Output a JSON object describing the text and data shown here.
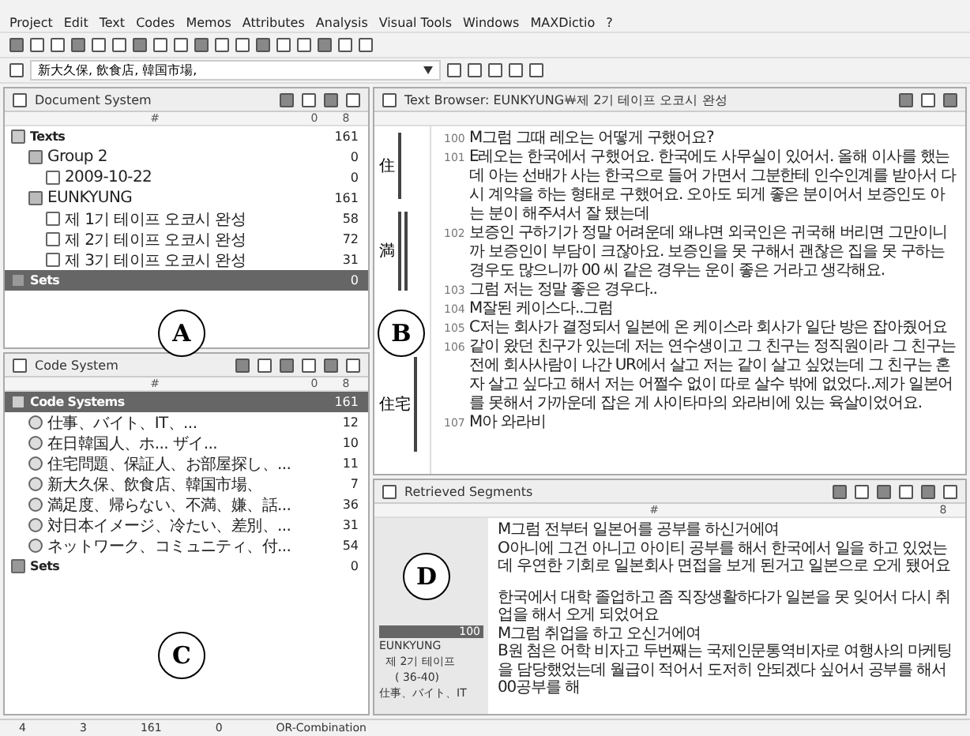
{
  "menu": [
    "Project",
    "Edit",
    "Text",
    "Codes",
    "Memos",
    "Attributes",
    "Analysis",
    "Visual Tools",
    "Windows",
    "MAXDictio",
    "?"
  ],
  "code_selector": {
    "value": "新大久保, 飲食店, 韓国市場,"
  },
  "document_system": {
    "title": "Document System",
    "columns": [
      "#",
      "0",
      "8"
    ],
    "tree": [
      {
        "label": "Texts",
        "count": "161",
        "kind": "root",
        "selected": false,
        "children": [
          {
            "label": "Group 2",
            "count": "0",
            "kind": "group",
            "selected": false,
            "children": [
              {
                "label": "2009-10-22",
                "count": "0",
                "kind": "doc",
                "selected": false
              }
            ]
          },
          {
            "label": "EUNKYUNG",
            "count": "161",
            "kind": "group",
            "selected": false,
            "children": [
              {
                "label": "제 1기 테이프 오코시 완성",
                "count": "58",
                "kind": "doc",
                "selected": false
              },
              {
                "label": "제 2기 테이프 오코시 완성",
                "count": "72",
                "kind": "doc",
                "selected": false
              },
              {
                "label": "제 3기 테이프 오코시 완성",
                "count": "31",
                "kind": "doc",
                "selected": false
              }
            ]
          }
        ]
      },
      {
        "label": "Sets",
        "count": "0",
        "kind": "set",
        "selected": true
      }
    ]
  },
  "code_system": {
    "title": "Code System",
    "columns": [
      "#",
      "0",
      "8"
    ],
    "tree": [
      {
        "label": "Code Systems",
        "count": "161",
        "kind": "root",
        "selected": true,
        "children": [
          {
            "label": "仕事、バイト、IT、...",
            "count": "12",
            "kind": "code",
            "selected": false
          },
          {
            "label": "在日韓国人、ホ... ザイ...",
            "count": "10",
            "kind": "code",
            "selected": false
          },
          {
            "label": "住宅問題、保証人、お部屋探し、...",
            "count": "11",
            "kind": "code",
            "selected": false
          },
          {
            "label": "新大久保、飲食店、韓国市場、",
            "count": "7",
            "kind": "code",
            "selected": false
          },
          {
            "label": "満足度、帰らない、不満、嫌、話...",
            "count": "36",
            "kind": "code",
            "selected": false
          },
          {
            "label": "対日本イメージ、冷たい、差別、...",
            "count": "31",
            "kind": "code",
            "selected": false
          },
          {
            "label": "ネットワーク、コミュニティ、付...",
            "count": "54",
            "kind": "code",
            "selected": false
          }
        ]
      },
      {
        "label": "Sets",
        "count": "0",
        "kind": "set",
        "selected": false
      }
    ]
  },
  "text_browser": {
    "title": "Text Browser: EUNKYUNG￦제 2기 테이프 오코시 완성",
    "codes": [
      {
        "label": "住",
        "kind": "short"
      },
      {
        "label": "満",
        "kind": "double"
      },
      {
        "label": "住宅",
        "kind": "long"
      }
    ],
    "paragraphs": [
      {
        "number": "100",
        "text": "M그럼 그때 레오는 어떻게 구했어요?"
      },
      {
        "number": "101",
        "text": "E레오는 한국에서 구했어요. 한국에도 사무실이 있어서. 올해 이사를 했는데 아는 선배가 사는 한국으로 들어 가면서 그분한테 인수인계를 받아서 다시 계약을 하는 형태로 구했어요. 오아도 되게 좋은 분이어서 보증인도 아는 분이 해주셔서 잘 됐는데"
      },
      {
        "number": "102",
        "text": "보증인 구하기가 정말 어려운데 왜냐면 외국인은 귀국해 버리면 그만이니까 보증인이 부담이 크잖아요. 보증인을 못 구해서 괜찮은 집을 못 구하는 경우도 많으니까 00 씨 같은 경우는 운이 좋은 거라고 생각해요."
      },
      {
        "number": "103",
        "text": "그럼 저는 정말 좋은 경우다.."
      },
      {
        "number": "104",
        "text": "M잘된 케이스다..그럼"
      },
      {
        "number": "105",
        "text": "C저는 회사가 결정되서 일본에 온 케이스라 회사가 일단 방은 잡아줬어요"
      },
      {
        "number": "106",
        "text": "같이 왔던 친구가 있는데 저는 연수생이고 그 친구는 정직원이라 그 친구는 전에 회사사람이 나간 UR에서 살고 저는 같이 살고 싶었는데 그 친구는 혼자 살고 싶다고 해서 저는 어쩔수 없이 따로 살수 밖에 없었다..제가 일본어를 못해서 가까운데 잡은 게 사이타마의 와라비에 있는 육살이었어요."
      },
      {
        "number": "107",
        "text": "M아 와라비"
      }
    ]
  },
  "retrieved": {
    "title": "Retrieved Segments",
    "columns": [
      "#",
      "8"
    ],
    "source": {
      "count": "100",
      "group": "EUNKYUNG",
      "doc": "제 2기 테이프",
      "range": "( 36-40)",
      "code": "仕事、バイト、IT"
    },
    "lines": [
      {
        "text": "M그럼 전부터 일본어를 공부를 하신거에여",
        "new_block": false
      },
      {
        "text": "O아니에 그건 아니고 아이티 공부를 해서 한국에서 일을 하고 있었는데 우연한 기회로 일본회사 면접을 보게 된거고 일본으로 오게 됐어요",
        "new_block": false
      },
      {
        "text": "한국에서 대학 졸업하고 좀 직장생활하다가 일본을 못 잊어서 다시 취업을 해서 오게 되었어요",
        "new_block": true
      },
      {
        "text": "M그럼 취업을 하고 오신거에여",
        "new_block": false
      },
      {
        "text": "B원 첨은 어학 비자고 두번째는 국제인문통역비자로 여행사의 마케팅을 담당했었는데 월급이 적어서 도저히 안되겠다 싶어서 공부를 해서 00공부를 해",
        "new_block": false
      }
    ]
  },
  "status_bar": [
    "4",
    "3",
    "161",
    "0",
    "OR-Combination"
  ],
  "annotations": [
    "A",
    "B",
    "C",
    "D"
  ]
}
